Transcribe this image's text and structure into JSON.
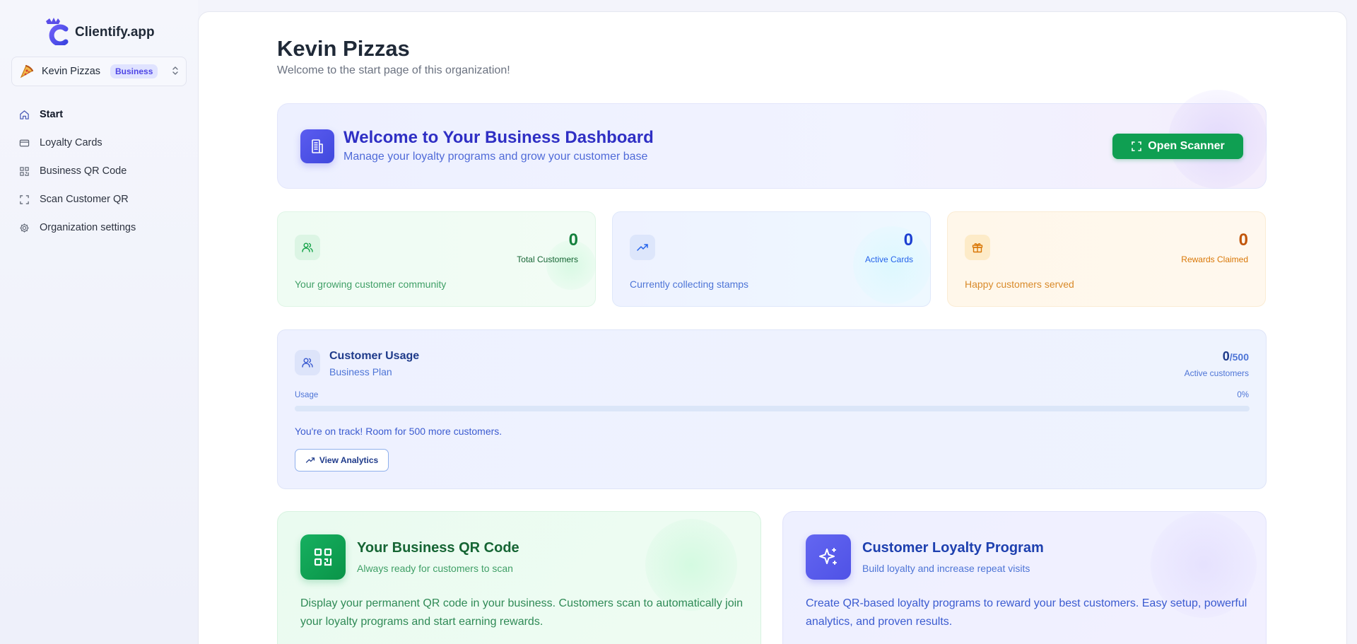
{
  "app": {
    "name": "Clientify.app"
  },
  "org": {
    "name": "Kevin Pizzas",
    "plan_badge": "Business"
  },
  "nav": {
    "items": [
      {
        "label": "Start",
        "active": true,
        "icon": "home-icon"
      },
      {
        "label": "Loyalty Cards",
        "icon": "card-icon"
      },
      {
        "label": "Business QR Code",
        "icon": "qr-icon"
      },
      {
        "label": "Scan Customer QR",
        "icon": "scan-icon"
      },
      {
        "label": "Organization settings",
        "icon": "gear-icon"
      }
    ]
  },
  "page": {
    "title": "Kevin Pizzas",
    "subtitle": "Welcome to the start page of this organization!"
  },
  "hero": {
    "title": "Welcome to Your Business Dashboard",
    "subtitle": "Manage your loyalty programs and grow your customer base",
    "scanner_button": "Open Scanner"
  },
  "stats": [
    {
      "value": "0",
      "label": "Total Customers",
      "description": "Your growing customer community",
      "icon": "users-icon"
    },
    {
      "value": "0",
      "label": "Active Cards",
      "description": "Currently collecting stamps",
      "icon": "trending-up-icon"
    },
    {
      "value": "0",
      "label": "Rewards Claimed",
      "description": "Happy customers served",
      "icon": "gift-icon"
    }
  ],
  "usage": {
    "title": "Customer Usage",
    "plan": "Business Plan",
    "current": "0",
    "max": "/500",
    "count_label": "Active customers",
    "usage_label": "Usage",
    "percent_label": "0%",
    "percent": 0,
    "message": "You're on track! Room for 500 more customers.",
    "analytics_button": "View Analytics"
  },
  "features": [
    {
      "title": "Your Business QR Code",
      "subtitle": "Always ready for customers to scan",
      "body": "Display your permanent QR code in your business. Customers scan to automatically join your loyalty programs and start earning rewards."
    },
    {
      "title": "Customer Loyalty Program",
      "subtitle": "Build loyalty and increase repeat visits",
      "body": "Create QR-based loyalty programs to reward your best customers. Easy setup, powerful analytics, and proven results."
    }
  ],
  "colors": {
    "brand": "#4f46e5",
    "success": "#0f9f52",
    "sidebar_bg": "#f3f4fb"
  }
}
